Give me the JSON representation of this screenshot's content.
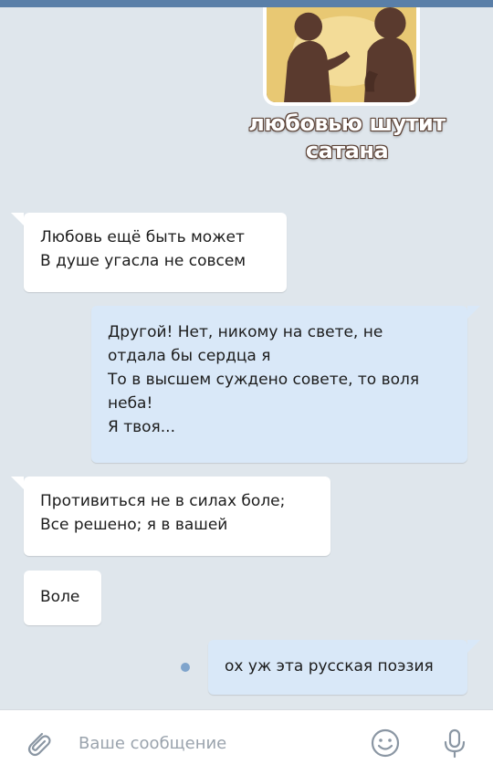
{
  "sticker": {
    "caption_lines": [
      "любовью шутит",
      "сатана"
    ]
  },
  "messages": [
    {
      "direction": "in",
      "lines": [
        "Любовь ещё быть может",
        "В душе угасла не совсем"
      ]
    },
    {
      "direction": "out",
      "lines": [
        "Другой! Нет, никому на свете, не",
        "отдала бы сердца я",
        "То в высшем суждено совете, то воля",
        "неба!",
        "Я твоя..."
      ]
    },
    {
      "direction": "in",
      "lines": [
        "Противиться не в силах боле;",
        "Все решено; я в вашей"
      ]
    },
    {
      "direction": "in",
      "lines": [
        "Воле"
      ]
    },
    {
      "direction": "out",
      "lines": [
        "ох уж эта русская поэзия"
      ]
    }
  ],
  "composer": {
    "placeholder": "Ваше сообщение",
    "icons": {
      "attach": "paperclip-icon",
      "emoji": "smiley-icon",
      "voice": "microphone-icon"
    }
  },
  "colors": {
    "background": "#dfe6ec",
    "incoming_bubble": "#ffffff",
    "outgoing_bubble": "#d9e8f8",
    "header_bar": "#5a7fa8",
    "unread_dot": "#7fa4cc"
  }
}
